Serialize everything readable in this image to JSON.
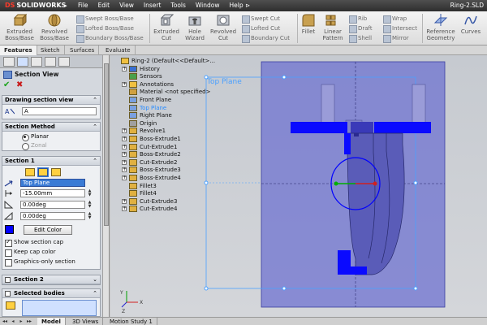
{
  "app": {
    "logo_text": "SOLIDWORKS",
    "doc_title": "Ring-2.SLD"
  },
  "menu": [
    "File",
    "Edit",
    "View",
    "Insert",
    "Tools",
    "Window",
    "Help"
  ],
  "ribbon": {
    "extruded_boss": "Extruded Boss/Base",
    "revolved_boss": "Revolved Boss/Base",
    "swept_boss": "Swept Boss/Base",
    "lofted_boss": "Lofted Boss/Base",
    "boundary_boss": "Boundary Boss/Base",
    "extruded_cut": "Extruded Cut",
    "hole_wizard": "Hole Wizard",
    "revolved_cut": "Revolved Cut",
    "swept_cut": "Swept Cut",
    "lofted_cut": "Lofted Cut",
    "boundary_cut": "Boundary Cut",
    "fillet": "Fillet",
    "linear_pattern": "Linear Pattern",
    "rib": "Rib",
    "draft": "Draft",
    "shell": "Shell",
    "wrap": "Wrap",
    "intersect": "Intersect",
    "mirror": "Mirror",
    "reference_geometry": "Reference Geometry",
    "curves": "Curves"
  },
  "command_tabs": [
    "Features",
    "Sketch",
    "Surfaces",
    "Evaluate"
  ],
  "property_manager": {
    "title": "Section View",
    "drawing_section_view": {
      "heading": "Drawing section view",
      "field_value": "A"
    },
    "section_method": {
      "heading": "Section Method",
      "planar": "Planar",
      "zonal": "Zonal"
    },
    "section1": {
      "heading": "Section 1",
      "plane": "Top Plane",
      "offset": "-15.00mm",
      "angle1": "0.00deg",
      "angle2": "0.00deg",
      "edit_color": "Edit Color",
      "show_section_cap": "Show section cap",
      "keep_cap_color": "Keep cap color",
      "graphics_only": "Graphics-only section"
    },
    "section2": {
      "heading": "Section 2"
    },
    "selected_bodies": {
      "heading": "Selected bodies"
    }
  },
  "feature_tree": [
    {
      "label": "Ring-2  (Default<<Default>...",
      "toggle": "",
      "selected": false,
      "indent": 0
    },
    {
      "label": "History",
      "toggle": "+",
      "selected": false,
      "indent": 1
    },
    {
      "label": "Sensors",
      "toggle": "",
      "selected": false,
      "indent": 1
    },
    {
      "label": "Annotations",
      "toggle": "+",
      "selected": false,
      "indent": 1
    },
    {
      "label": "Material <not specified>",
      "toggle": "",
      "selected": false,
      "indent": 1
    },
    {
      "label": "Front Plane",
      "toggle": "",
      "selected": false,
      "indent": 1
    },
    {
      "label": "Top Plane",
      "toggle": "",
      "selected": true,
      "indent": 1
    },
    {
      "label": "Right Plane",
      "toggle": "",
      "selected": false,
      "indent": 1
    },
    {
      "label": "Origin",
      "toggle": "",
      "selected": false,
      "indent": 1
    },
    {
      "label": "Revolve1",
      "toggle": "+",
      "selected": false,
      "indent": 1
    },
    {
      "label": "Boss-Extrude1",
      "toggle": "+",
      "selected": false,
      "indent": 1
    },
    {
      "label": "Cut-Extrude1",
      "toggle": "+",
      "selected": false,
      "indent": 1
    },
    {
      "label": "Boss-Extrude2",
      "toggle": "+",
      "selected": false,
      "indent": 1
    },
    {
      "label": "Cut-Extrude2",
      "toggle": "+",
      "selected": false,
      "indent": 1
    },
    {
      "label": "Boss-Extrude3",
      "toggle": "+",
      "selected": false,
      "indent": 1
    },
    {
      "label": "Boss-Extrude4",
      "toggle": "+",
      "selected": false,
      "indent": 1
    },
    {
      "label": "Fillet3",
      "toggle": "",
      "selected": false,
      "indent": 1
    },
    {
      "label": "Fillet4",
      "toggle": "",
      "selected": false,
      "indent": 1
    },
    {
      "label": "Cut-Extrude3",
      "toggle": "+",
      "selected": false,
      "indent": 1
    },
    {
      "label": "Cut-Extrude4",
      "toggle": "+",
      "selected": false,
      "indent": 1
    }
  ],
  "viewport": {
    "plane_label": "Top Plane"
  },
  "bottom_tabs": [
    "Model",
    "3D Views",
    "Motion Study 1"
  ],
  "colors": {
    "accent": "#0000ff",
    "plane_fill": "#6b6fd0",
    "selection_text": "#2a8cff"
  }
}
